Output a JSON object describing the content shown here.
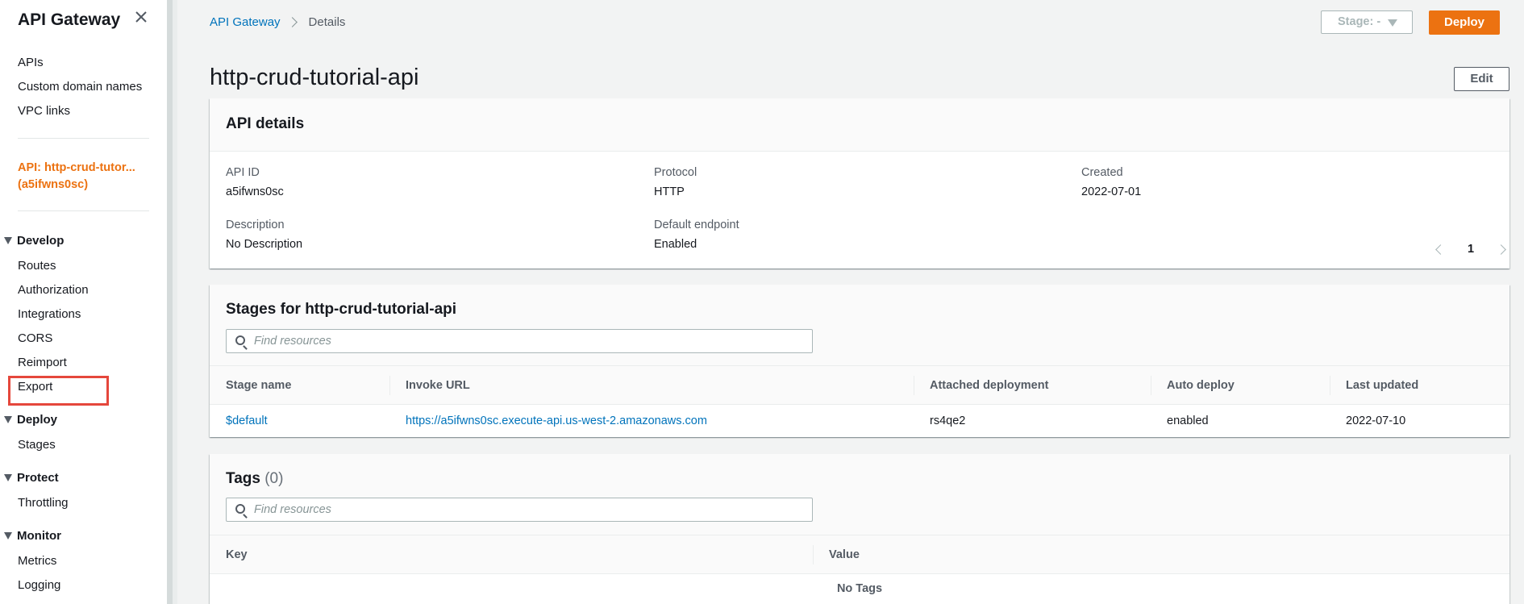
{
  "sidebar": {
    "title": "API Gateway",
    "top_links": [
      "APIs",
      "Custom domain names",
      "VPC links"
    ],
    "api_label": "API: http-crud-tutor...\n(a5ifwns0sc)",
    "api_label_line1": "API: http-crud-tutor...",
    "api_label_line2": "(a5ifwns0sc)",
    "sections": {
      "develop": {
        "label": "Develop",
        "items": [
          "Routes",
          "Authorization",
          "Integrations",
          "CORS",
          "Reimport",
          "Export"
        ]
      },
      "deploy": {
        "label": "Deploy",
        "items": [
          "Stages"
        ]
      },
      "protect": {
        "label": "Protect",
        "items": [
          "Throttling"
        ]
      },
      "monitor": {
        "label": "Monitor",
        "items": [
          "Metrics",
          "Logging"
        ]
      }
    },
    "highlighted_item": "Export",
    "highlight_color": "#e5473c"
  },
  "breadcrumb": {
    "root": "API Gateway",
    "current": "Details"
  },
  "header": {
    "stage_select": "Stage: -",
    "deploy_label": "Deploy",
    "deploy_color": "#ec7211",
    "page_title": "http-crud-tutorial-api",
    "edit_label": "Edit"
  },
  "api_details": {
    "title": "API details",
    "api_id_label": "API ID",
    "api_id": "a5ifwns0sc",
    "protocol_label": "Protocol",
    "protocol": "HTTP",
    "created_label": "Created",
    "created": "2022-07-01",
    "description_label": "Description",
    "description": "No Description",
    "default_endpoint_label": "Default endpoint",
    "default_endpoint": "Enabled"
  },
  "stages": {
    "title": "Stages for http-crud-tutorial-api",
    "search_placeholder": "Find resources",
    "columns": [
      "Stage name",
      "Invoke URL",
      "Attached deployment",
      "Auto deploy",
      "Last updated"
    ],
    "rows": [
      {
        "stage_name": "$default",
        "invoke_url": "https://a5ifwns0sc.execute-api.us-west-2.amazonaws.com",
        "attached_deployment": "rs4qe2",
        "auto_deploy": "enabled",
        "last_updated": "2022-07-10"
      }
    ]
  },
  "tags": {
    "title": "Tags",
    "count": "(0)",
    "search_placeholder": "Find resources",
    "page": "1",
    "columns": [
      "Key",
      "Value"
    ],
    "empty_text": "No Tags"
  },
  "colors": {
    "link": "#0073bb",
    "accent": "#ec7211"
  }
}
